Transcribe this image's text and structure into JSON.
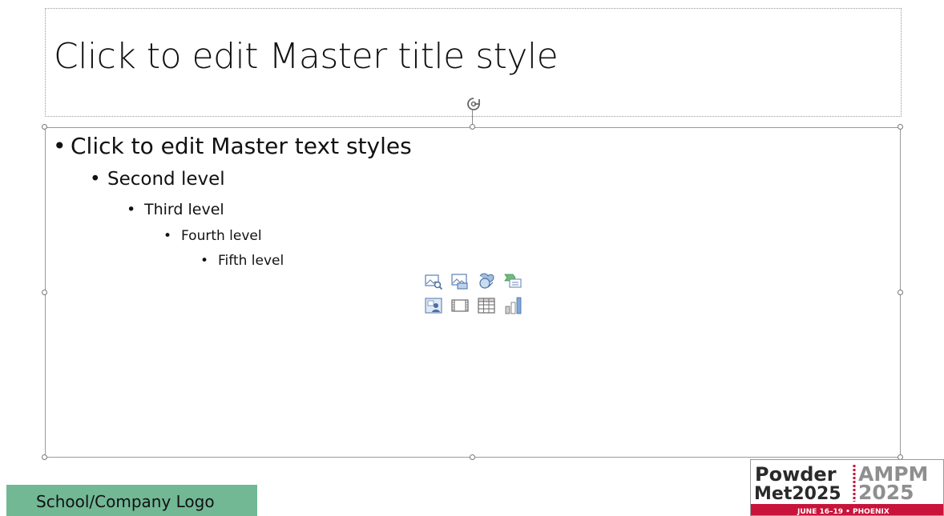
{
  "slide": {
    "title_placeholder": "Click to edit Master title style",
    "content_levels": [
      "Click to edit Master text styles",
      "Second level",
      "Third level",
      "Fourth level",
      "Fifth level"
    ],
    "bullet_char": "•",
    "insert_icons": [
      "pictures-icon",
      "online-pictures-icon",
      "icons-icon",
      "smartart-icon",
      "cameo-icon",
      "video-icon",
      "table-icon",
      "chart-icon"
    ]
  },
  "footer": {
    "logo_placeholder": "School/Company Logo",
    "logo_bg": "#72b895"
  },
  "event_logo": {
    "line1": "Powder",
    "line2": "Met2025",
    "right1": "AMPM",
    "right2": "2025",
    "banner": "JUNE 16–19 • PHOENIX",
    "colors": {
      "dark": "#2a2a2a",
      "red": "#c8143a",
      "grey": "#8f8f8f"
    }
  }
}
